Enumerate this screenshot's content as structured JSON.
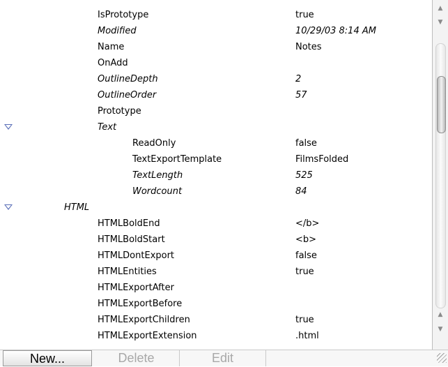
{
  "attributes": [
    {
      "name": "IsPrototype",
      "value": "true",
      "italic": false,
      "indent": 1,
      "disclosure": false
    },
    {
      "name": "Modified",
      "value": "10/29/03 8:14 AM",
      "italic": true,
      "indent": 1,
      "disclosure": false
    },
    {
      "name": "Name",
      "value": "Notes",
      "italic": false,
      "indent": 1,
      "disclosure": false
    },
    {
      "name": "OnAdd",
      "value": "",
      "italic": false,
      "indent": 1,
      "disclosure": false
    },
    {
      "name": "OutlineDepth",
      "value": "2",
      "italic": true,
      "indent": 1,
      "disclosure": false
    },
    {
      "name": "OutlineOrder",
      "value": "57",
      "italic": true,
      "indent": 1,
      "disclosure": false
    },
    {
      "name": "Prototype",
      "value": "",
      "italic": false,
      "indent": 1,
      "disclosure": false
    },
    {
      "name": "Text",
      "value": "",
      "italic": true,
      "indent": 1,
      "disclosure": true
    },
    {
      "name": "ReadOnly",
      "value": "false",
      "italic": false,
      "indent": 2,
      "disclosure": false
    },
    {
      "name": "TextExportTemplate",
      "value": "FilmsFolded",
      "italic": false,
      "indent": 2,
      "disclosure": false
    },
    {
      "name": "TextLength",
      "value": "525",
      "italic": true,
      "indent": 2,
      "disclosure": false
    },
    {
      "name": "Wordcount",
      "value": "84",
      "italic": true,
      "indent": 2,
      "disclosure": false
    },
    {
      "name": "HTML",
      "value": "",
      "italic": true,
      "indent": 0,
      "disclosure": true
    },
    {
      "name": "HTMLBoldEnd",
      "value": "</b>",
      "italic": false,
      "indent": 1,
      "disclosure": false
    },
    {
      "name": "HTMLBoldStart",
      "value": "<b>",
      "italic": false,
      "indent": 1,
      "disclosure": false
    },
    {
      "name": "HTMLDontExport",
      "value": "false",
      "italic": false,
      "indent": 1,
      "disclosure": false
    },
    {
      "name": "HTMLEntities",
      "value": "true",
      "italic": false,
      "indent": 1,
      "disclosure": false
    },
    {
      "name": "HTMLExportAfter",
      "value": "",
      "italic": false,
      "indent": 1,
      "disclosure": false
    },
    {
      "name": "HTMLExportBefore",
      "value": "",
      "italic": false,
      "indent": 1,
      "disclosure": false
    },
    {
      "name": "HTMLExportChildren",
      "value": "true",
      "italic": false,
      "indent": 1,
      "disclosure": false
    },
    {
      "name": "HTMLExportExtension",
      "value": ".html",
      "italic": false,
      "indent": 1,
      "disclosure": false
    }
  ],
  "scrollbar": {
    "up_glyph": "▲",
    "down_glyph": "▼",
    "position": 0.12
  },
  "toolbar": {
    "new_label": "New...",
    "delete_label": "Delete",
    "edit_label": "Edit"
  },
  "colors": {
    "disclosure": "#5a6fb8",
    "disabled_text": "#a8a8a8"
  },
  "icons": {
    "disclosure": "disclosure-triangle-icon",
    "resize": "resize-grip-icon"
  }
}
